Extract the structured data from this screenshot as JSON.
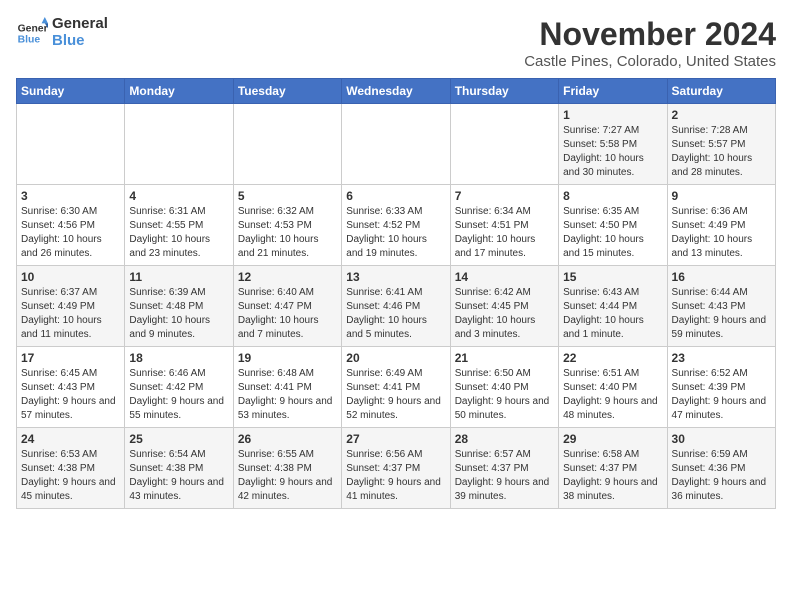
{
  "logo": {
    "line1": "General",
    "line2": "Blue"
  },
  "title": "November 2024",
  "location": "Castle Pines, Colorado, United States",
  "weekdays": [
    "Sunday",
    "Monday",
    "Tuesday",
    "Wednesday",
    "Thursday",
    "Friday",
    "Saturday"
  ],
  "weeks": [
    [
      {
        "day": "",
        "info": ""
      },
      {
        "day": "",
        "info": ""
      },
      {
        "day": "",
        "info": ""
      },
      {
        "day": "",
        "info": ""
      },
      {
        "day": "",
        "info": ""
      },
      {
        "day": "1",
        "info": "Sunrise: 7:27 AM\nSunset: 5:58 PM\nDaylight: 10 hours and 30 minutes."
      },
      {
        "day": "2",
        "info": "Sunrise: 7:28 AM\nSunset: 5:57 PM\nDaylight: 10 hours and 28 minutes."
      }
    ],
    [
      {
        "day": "3",
        "info": "Sunrise: 6:30 AM\nSunset: 4:56 PM\nDaylight: 10 hours and 26 minutes."
      },
      {
        "day": "4",
        "info": "Sunrise: 6:31 AM\nSunset: 4:55 PM\nDaylight: 10 hours and 23 minutes."
      },
      {
        "day": "5",
        "info": "Sunrise: 6:32 AM\nSunset: 4:53 PM\nDaylight: 10 hours and 21 minutes."
      },
      {
        "day": "6",
        "info": "Sunrise: 6:33 AM\nSunset: 4:52 PM\nDaylight: 10 hours and 19 minutes."
      },
      {
        "day": "7",
        "info": "Sunrise: 6:34 AM\nSunset: 4:51 PM\nDaylight: 10 hours and 17 minutes."
      },
      {
        "day": "8",
        "info": "Sunrise: 6:35 AM\nSunset: 4:50 PM\nDaylight: 10 hours and 15 minutes."
      },
      {
        "day": "9",
        "info": "Sunrise: 6:36 AM\nSunset: 4:49 PM\nDaylight: 10 hours and 13 minutes."
      }
    ],
    [
      {
        "day": "10",
        "info": "Sunrise: 6:37 AM\nSunset: 4:49 PM\nDaylight: 10 hours and 11 minutes."
      },
      {
        "day": "11",
        "info": "Sunrise: 6:39 AM\nSunset: 4:48 PM\nDaylight: 10 hours and 9 minutes."
      },
      {
        "day": "12",
        "info": "Sunrise: 6:40 AM\nSunset: 4:47 PM\nDaylight: 10 hours and 7 minutes."
      },
      {
        "day": "13",
        "info": "Sunrise: 6:41 AM\nSunset: 4:46 PM\nDaylight: 10 hours and 5 minutes."
      },
      {
        "day": "14",
        "info": "Sunrise: 6:42 AM\nSunset: 4:45 PM\nDaylight: 10 hours and 3 minutes."
      },
      {
        "day": "15",
        "info": "Sunrise: 6:43 AM\nSunset: 4:44 PM\nDaylight: 10 hours and 1 minute."
      },
      {
        "day": "16",
        "info": "Sunrise: 6:44 AM\nSunset: 4:43 PM\nDaylight: 9 hours and 59 minutes."
      }
    ],
    [
      {
        "day": "17",
        "info": "Sunrise: 6:45 AM\nSunset: 4:43 PM\nDaylight: 9 hours and 57 minutes."
      },
      {
        "day": "18",
        "info": "Sunrise: 6:46 AM\nSunset: 4:42 PM\nDaylight: 9 hours and 55 minutes."
      },
      {
        "day": "19",
        "info": "Sunrise: 6:48 AM\nSunset: 4:41 PM\nDaylight: 9 hours and 53 minutes."
      },
      {
        "day": "20",
        "info": "Sunrise: 6:49 AM\nSunset: 4:41 PM\nDaylight: 9 hours and 52 minutes."
      },
      {
        "day": "21",
        "info": "Sunrise: 6:50 AM\nSunset: 4:40 PM\nDaylight: 9 hours and 50 minutes."
      },
      {
        "day": "22",
        "info": "Sunrise: 6:51 AM\nSunset: 4:40 PM\nDaylight: 9 hours and 48 minutes."
      },
      {
        "day": "23",
        "info": "Sunrise: 6:52 AM\nSunset: 4:39 PM\nDaylight: 9 hours and 47 minutes."
      }
    ],
    [
      {
        "day": "24",
        "info": "Sunrise: 6:53 AM\nSunset: 4:38 PM\nDaylight: 9 hours and 45 minutes."
      },
      {
        "day": "25",
        "info": "Sunrise: 6:54 AM\nSunset: 4:38 PM\nDaylight: 9 hours and 43 minutes."
      },
      {
        "day": "26",
        "info": "Sunrise: 6:55 AM\nSunset: 4:38 PM\nDaylight: 9 hours and 42 minutes."
      },
      {
        "day": "27",
        "info": "Sunrise: 6:56 AM\nSunset: 4:37 PM\nDaylight: 9 hours and 41 minutes."
      },
      {
        "day": "28",
        "info": "Sunrise: 6:57 AM\nSunset: 4:37 PM\nDaylight: 9 hours and 39 minutes."
      },
      {
        "day": "29",
        "info": "Sunrise: 6:58 AM\nSunset: 4:37 PM\nDaylight: 9 hours and 38 minutes."
      },
      {
        "day": "30",
        "info": "Sunrise: 6:59 AM\nSunset: 4:36 PM\nDaylight: 9 hours and 36 minutes."
      }
    ]
  ]
}
